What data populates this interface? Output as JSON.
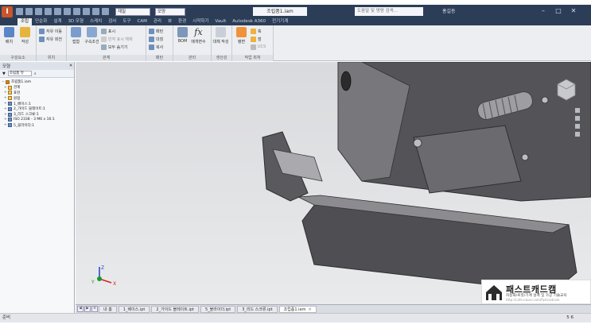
{
  "app": {
    "logo_letter": "I",
    "document_title": "조립품1.iam",
    "help_search_placeholder": "도움말 및 명령 검색...",
    "user_name": "홍길동",
    "material_select": "재질",
    "appearance_select": "모양",
    "window_controls": [
      "–",
      "□",
      "✕"
    ]
  },
  "ribbon_tabs": [
    {
      "label": "조립",
      "active": true
    },
    {
      "label": "단순화"
    },
    {
      "label": "설계"
    },
    {
      "label": "3D 모형"
    },
    {
      "label": "스케치"
    },
    {
      "label": "검사"
    },
    {
      "label": "도구"
    },
    {
      "label": "CAM"
    },
    {
      "label": "관리"
    },
    {
      "label": "뷰"
    },
    {
      "label": "환경"
    },
    {
      "label": "시작하기"
    },
    {
      "label": "Vault"
    },
    {
      "label": "Autodesk A360"
    },
    {
      "label": "전기기계"
    }
  ],
  "ribbon": {
    "component": {
      "title": "구성요소",
      "place": "배치",
      "create": "작성"
    },
    "position": {
      "title": "위치",
      "free_move": "자유 이동",
      "free_rotate": "자유 회전"
    },
    "relationships": {
      "title": "관계",
      "constrain": "구속조건",
      "joint": "접합",
      "show": "표시",
      "show_sick": "빈약 표시 해제",
      "hide_all": "모두 숨기기"
    },
    "pattern": {
      "title": "패턴",
      "pattern": "패턴",
      "mirror": "대칭",
      "copy": "복사"
    },
    "manage": {
      "title": "관리",
      "bom": "BOM",
      "parameters": "매개변수"
    },
    "productivity": {
      "title": "생산성",
      "replace": "대체 작성"
    },
    "work_features": {
      "title": "작업 피쳐",
      "plane": "평면",
      "axis": "축",
      "point": "점",
      "ucs": "UCS"
    }
  },
  "browser": {
    "title": "모형",
    "close": "✕",
    "filter_label": "조립품 뷰",
    "items": [
      {
        "label": "조립품1.iam",
        "level": 0,
        "kind": "root",
        "exp": "−"
      },
      {
        "label": "관계",
        "level": 1,
        "kind": "folder",
        "exp": "+"
      },
      {
        "label": "표현",
        "level": 1,
        "kind": "folder",
        "exp": "+"
      },
      {
        "label": "원점",
        "level": 1,
        "kind": "folder",
        "exp": "+"
      },
      {
        "label": "1_베이스:1",
        "level": 1,
        "kind": "part",
        "exp": "+"
      },
      {
        "label": "2_가이드 블레이트:1",
        "level": 1,
        "kind": "part",
        "exp": "+"
      },
      {
        "label": "3_리드 스크류:1",
        "level": 1,
        "kind": "part",
        "exp": "+"
      },
      {
        "label": "ISO 2338 - 3 M6 x 16:1",
        "level": 1,
        "kind": "part",
        "exp": "+"
      },
      {
        "label": "5_블라이더:1",
        "level": 1,
        "kind": "part",
        "exp": "+"
      }
    ]
  },
  "doc_tabs": {
    "nav": [
      "◀",
      "▶",
      "≡"
    ],
    "tabs": [
      {
        "label": "내 홈",
        "active": false
      },
      {
        "label": "1_베이스.ipt",
        "active": false
      },
      {
        "label": "2_가이드 블레이트.ipt",
        "active": false
      },
      {
        "label": "5_블라이더.ipt",
        "active": false
      },
      {
        "label": "3_리드 스크류.ipt",
        "active": false
      },
      {
        "label": "조립품1.iam",
        "active": true
      }
    ],
    "close_glyph": "✕"
  },
  "status": {
    "left": "준비",
    "right": "5 6"
  },
  "watermark": {
    "brand": "패스트캐드캠",
    "tagline": "자동화/로봇/기계 설계 및 가공 기술교육",
    "url": "http://cafe.naver.com/fastcadcam"
  },
  "axes": {
    "x": "X",
    "y": "Y",
    "z": "Z"
  },
  "colors": {
    "title_bg": "#2c3e57",
    "ribbon_bg": "#eceef1",
    "viewport_bg": "#dcdde0",
    "model_dark": "#4e4e52",
    "model_face": "#6a6a6e",
    "axis_x": "#d62020",
    "axis_y": "#1a9a2a",
    "axis_z": "#2040c8"
  }
}
